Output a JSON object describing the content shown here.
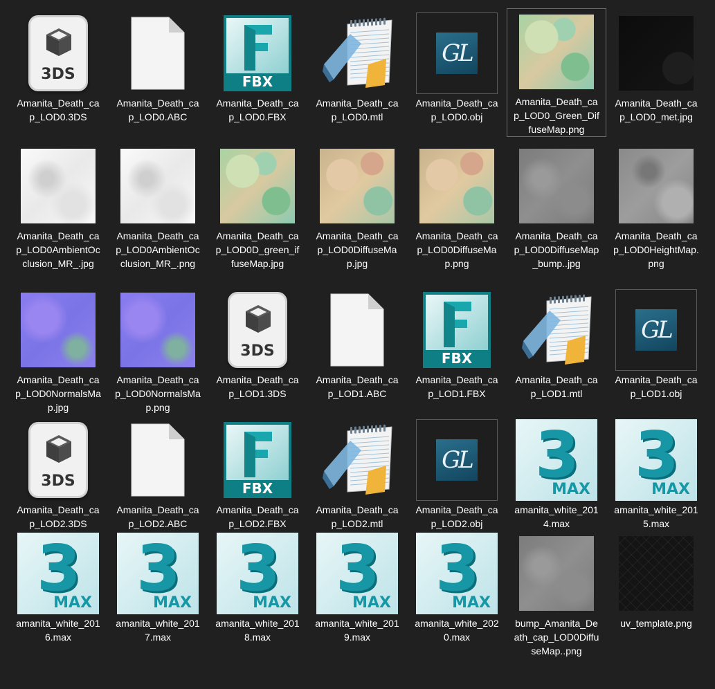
{
  "items": [
    {
      "label": "Amanita_Death_cap_LOD0.3DS",
      "icon": "3ds-file-icon",
      "kind": "3ds"
    },
    {
      "label": "Amanita_Death_cap_LOD0.ABC",
      "icon": "blank-file-icon",
      "kind": "blank"
    },
    {
      "label": "Amanita_Death_cap_LOD0.FBX",
      "icon": "fbx-file-icon",
      "kind": "fbx"
    },
    {
      "label": "Amanita_Death_cap_LOD0.mtl",
      "icon": "notepad-icon",
      "kind": "notepad"
    },
    {
      "label": "Amanita_Death_cap_LOD0.obj",
      "icon": "gl-file-icon",
      "kind": "gl"
    },
    {
      "label": "Amanita_Death_cap_LOD0_Green_DiffuseMap.png",
      "icon": "green-diffuse-thumbnail",
      "kind": "tex",
      "selected": true
    },
    {
      "label": "Amanita_Death_cap_LOD0_met.jpg",
      "icon": "metal-map-thumbnail",
      "kind": "tex"
    },
    {
      "label": "Amanita_Death_cap_LOD0AmbientOcclusion_MR_.jpg",
      "icon": "ao-map-thumbnail",
      "kind": "tex"
    },
    {
      "label": "Amanita_Death_cap_LOD0AmbientOcclusion_MR_.png",
      "icon": "ao-map-thumbnail",
      "kind": "tex"
    },
    {
      "label": "Amanita_Death_cap_LOD0D_green_iffuseMap.jpg",
      "icon": "green-diffuse-thumbnail",
      "kind": "tex"
    },
    {
      "label": "Amanita_Death_cap_LOD0DiffuseMap.jpg",
      "icon": "diffuse-map-thumbnail",
      "kind": "tex"
    },
    {
      "label": "Amanita_Death_cap_LOD0DiffuseMap.png",
      "icon": "diffuse-map-thumbnail",
      "kind": "tex"
    },
    {
      "label": "Amanita_Death_cap_LOD0DiffuseMap_bump..jpg",
      "icon": "bump-map-thumbnail",
      "kind": "tex"
    },
    {
      "label": "Amanita_Death_cap_LOD0HeightMap.png",
      "icon": "height-map-thumbnail",
      "kind": "tex"
    },
    {
      "label": "Amanita_Death_cap_LOD0NormalsMap.jpg",
      "icon": "normal-map-thumbnail",
      "kind": "tex"
    },
    {
      "label": "Amanita_Death_cap_LOD0NormalsMap.png",
      "icon": "normal-map-thumbnail",
      "kind": "tex"
    },
    {
      "label": "Amanita_Death_cap_LOD1.3DS",
      "icon": "3ds-file-icon",
      "kind": "3ds"
    },
    {
      "label": "Amanita_Death_cap_LOD1.ABC",
      "icon": "blank-file-icon",
      "kind": "blank"
    },
    {
      "label": "Amanita_Death_cap_LOD1.FBX",
      "icon": "fbx-file-icon",
      "kind": "fbx"
    },
    {
      "label": "Amanita_Death_cap_LOD1.mtl",
      "icon": "notepad-icon",
      "kind": "notepad"
    },
    {
      "label": "Amanita_Death_cap_LOD1.obj",
      "icon": "gl-file-icon",
      "kind": "gl"
    },
    {
      "label": "Amanita_Death_cap_LOD2.3DS",
      "icon": "3ds-file-icon",
      "kind": "3ds"
    },
    {
      "label": "Amanita_Death_cap_LOD2.ABC",
      "icon": "blank-file-icon",
      "kind": "blank"
    },
    {
      "label": "Amanita_Death_cap_LOD2.FBX",
      "icon": "fbx-file-icon",
      "kind": "fbx"
    },
    {
      "label": "Amanita_Death_cap_LOD2.mtl",
      "icon": "notepad-icon",
      "kind": "notepad"
    },
    {
      "label": "Amanita_Death_cap_LOD2.obj",
      "icon": "gl-file-icon",
      "kind": "gl"
    },
    {
      "label": "amanita_white_2014.max",
      "icon": "3dsmax-file-icon",
      "kind": "max"
    },
    {
      "label": "amanita_white_2015.max",
      "icon": "3dsmax-file-icon",
      "kind": "max"
    },
    {
      "label": "amanita_white_2016.max",
      "icon": "3dsmax-file-icon",
      "kind": "max"
    },
    {
      "label": "amanita_white_2017.max",
      "icon": "3dsmax-file-icon",
      "kind": "max"
    },
    {
      "label": "amanita_white_2018.max",
      "icon": "3dsmax-file-icon",
      "kind": "max"
    },
    {
      "label": "amanita_white_2019.max",
      "icon": "3dsmax-file-icon",
      "kind": "max"
    },
    {
      "label": "amanita_white_2020.max",
      "icon": "3dsmax-file-icon",
      "kind": "max"
    },
    {
      "label": "bump_Amanita_Death_cap_LOD0DiffuseMap..png",
      "icon": "bump-map-thumbnail",
      "kind": "tex"
    },
    {
      "label": "uv_template.png",
      "icon": "uv-template-thumbnail",
      "kind": "tex"
    }
  ],
  "icon_text": {
    "3ds": "3DS",
    "fbx_letter": "F",
    "fbx": "FBX",
    "gl": "GL",
    "max_digit": "3",
    "max": "MAX"
  },
  "colors": {
    "background": "#202020",
    "selection_border": "#6e6e6e",
    "max_accent": "#1797a6",
    "fbx_accent": "#0f7f86"
  }
}
